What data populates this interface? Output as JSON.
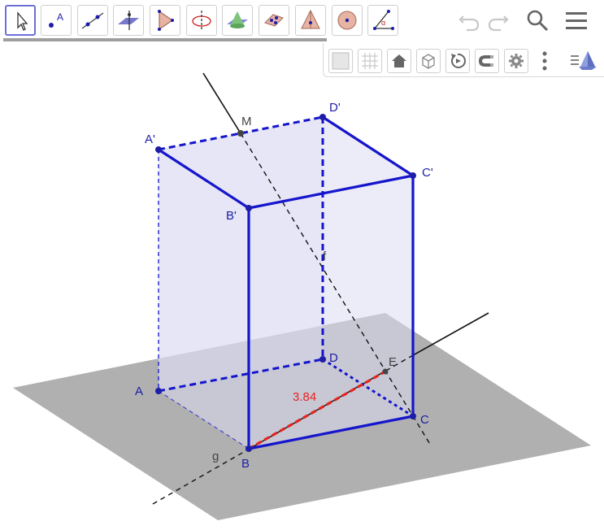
{
  "toolbar": {
    "tools": [
      {
        "name": "move-tool",
        "icon": "move-cursor-icon",
        "active": true
      },
      {
        "name": "point-tool",
        "icon": "point-icon",
        "letter": "A"
      },
      {
        "name": "line-tool",
        "icon": "line-icon"
      },
      {
        "name": "perpendicular-plane-tool",
        "icon": "plane-icon"
      },
      {
        "name": "pyramid-tool",
        "icon": "triangle-icon"
      },
      {
        "name": "rotate-around-line-tool",
        "icon": "rotate-axis-icon"
      },
      {
        "name": "cone-tool",
        "icon": "cone-icon"
      },
      {
        "name": "net-tool",
        "icon": "net-icon"
      },
      {
        "name": "pyramid-solid-tool",
        "icon": "pyramid-icon"
      },
      {
        "name": "sphere-tool",
        "icon": "sphere-icon"
      },
      {
        "name": "angle-tool",
        "icon": "angle-icon",
        "letter": "α"
      }
    ],
    "header_icons": [
      "undo-icon",
      "redo-icon",
      "search-icon",
      "menu-icon"
    ]
  },
  "style_bar": {
    "icons": [
      "color-swatch-icon",
      "grid-icon",
      "home-icon",
      "axes-box-icon",
      "rotate-view-icon",
      "magnet-icon",
      "gear-icon",
      "more-vert-icon",
      "view-direction-icon"
    ]
  },
  "colors": {
    "accent": "#1a1acc",
    "edge_blue": "#1515cc",
    "label_blue": "#1d1da8",
    "measure_red": "#e8221d",
    "plane_gray": "#a6a6a6",
    "face_fill": "#dcdcf3"
  },
  "labels": {
    "A": "A",
    "B": "B",
    "C": "C",
    "D": "D",
    "A_prime": "A'",
    "B_prime": "B'",
    "C_prime": "C'",
    "D_prime": "D'",
    "M": "M",
    "E": "E",
    "f": "f",
    "g": "g",
    "segment_value": "3.84"
  }
}
